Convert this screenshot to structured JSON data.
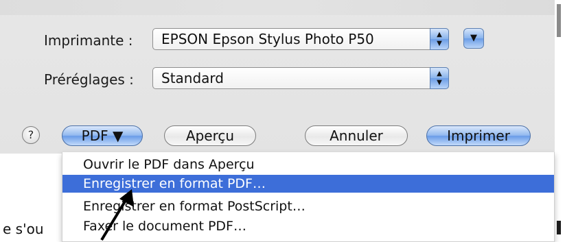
{
  "dialog": {
    "printer_label": "Imprimante :",
    "printer_value": "EPSON Epson Stylus Photo P50",
    "presets_label": "Préréglages :",
    "presets_value": "Standard",
    "stepper_up": "▲",
    "stepper_down": "▼",
    "expand_glyph": "▼"
  },
  "buttons": {
    "help": "?",
    "pdf": "PDF ▼",
    "preview": "Aperçu",
    "cancel": "Annuler",
    "print": "Imprimer"
  },
  "pdf_menu": {
    "items": [
      "Ouvrir le PDF dans Aperçu",
      "Enregistrer en format PDF…",
      "Enregistrer en format PostScript…",
      "Faxer le document PDF…"
    ],
    "selected_index": 1
  },
  "background_text": {
    "left": "e s'ou",
    "right": "n"
  },
  "colors": {
    "selection": "#3d6ed9",
    "dialog_bg": "#e5e5e5",
    "aqua_blue": "#6a9ce8"
  }
}
